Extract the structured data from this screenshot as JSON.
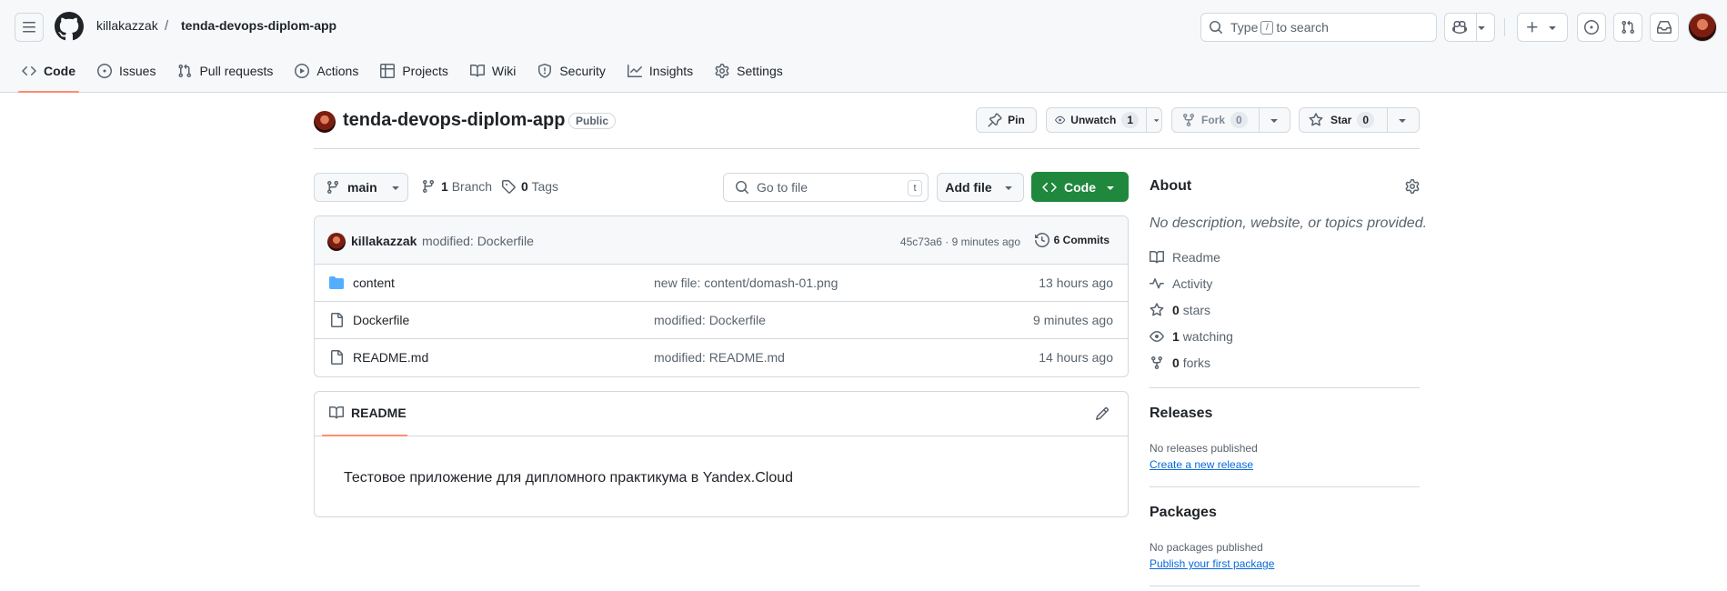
{
  "header": {
    "owner": "killakazzak",
    "separator": "/",
    "repo": "tenda-devops-diplom-app",
    "search": {
      "prefix": "Type",
      "key": "/",
      "suffix": "to search"
    }
  },
  "nav": {
    "tabs": [
      {
        "label": "Code",
        "icon": "code-icon",
        "active": true
      },
      {
        "label": "Issues",
        "icon": "issue-icon"
      },
      {
        "label": "Pull requests",
        "icon": "pull-request-icon"
      },
      {
        "label": "Actions",
        "icon": "play-icon"
      },
      {
        "label": "Projects",
        "icon": "table-icon"
      },
      {
        "label": "Wiki",
        "icon": "book-icon"
      },
      {
        "label": "Security",
        "icon": "shield-icon"
      },
      {
        "label": "Insights",
        "icon": "graph-icon"
      },
      {
        "label": "Settings",
        "icon": "gear-icon"
      }
    ]
  },
  "repo": {
    "name": "tenda-devops-diplom-app",
    "visibility": "Public",
    "pin_label": "Pin",
    "unwatch_label": "Unwatch",
    "watch_count": "1",
    "fork_label": "Fork",
    "fork_count": "0",
    "star_label": "Star",
    "star_count": "0"
  },
  "filenav": {
    "branch": "main",
    "branch_count": "1",
    "branch_label": "Branch",
    "tag_count": "0",
    "tag_label": "Tags",
    "goto_placeholder": "Go to file",
    "goto_key": "t",
    "add_file": "Add file",
    "code_button": "Code"
  },
  "commit": {
    "author": "killakazzak",
    "message": "modified: Dockerfile",
    "sha_time": "45c73a6 · 9 minutes ago",
    "commits_label": "6 Commits"
  },
  "files": [
    {
      "name": "content",
      "type": "folder",
      "message": "new file: content/domash-01.png",
      "age": "13 hours ago"
    },
    {
      "name": "Dockerfile",
      "type": "file",
      "message": "modified: Dockerfile",
      "age": "9 minutes ago"
    },
    {
      "name": "README.md",
      "type": "file",
      "message": "modified: README.md",
      "age": "14 hours ago"
    }
  ],
  "readme": {
    "tab_label": "README",
    "content": "Тестовое приложение для дипломного практикума в Yandex.Cloud"
  },
  "about": {
    "heading": "About",
    "description": "No description, website, or topics provided.",
    "readme_link": "Readme",
    "activity_link": "Activity",
    "stars_count": "0",
    "stars_label": "stars",
    "watching_count": "1",
    "watching_label": "watching",
    "forks_count": "0",
    "forks_label": "forks"
  },
  "releases": {
    "heading": "Releases",
    "none": "No releases published",
    "create_link": "Create a new release"
  },
  "packages": {
    "heading": "Packages",
    "none": "No packages published",
    "publish_link": "Publish your first package"
  },
  "colors": {
    "accent_green": "#1f883d",
    "tab_underline": "#fd8c73",
    "link_blue": "#0969da"
  }
}
